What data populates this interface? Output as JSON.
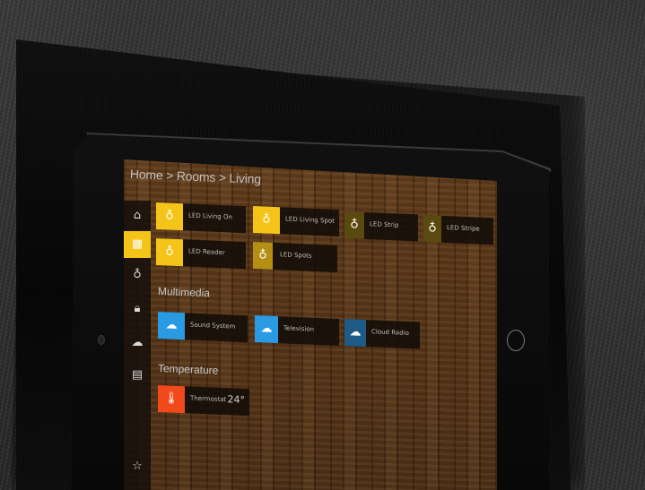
{
  "breadcrumb": "Home > Rooms > Living",
  "sidebar": [
    {
      "icon": "home-icon",
      "glyph": "⌂",
      "active": false
    },
    {
      "icon": "rooms-icon",
      "glyph": "▦",
      "active": true
    },
    {
      "icon": "light-bulb-icon",
      "glyph": "♁",
      "active": false
    },
    {
      "icon": "lock-icon",
      "glyph": "🔒︎",
      "active": false
    },
    {
      "icon": "cloud-icon",
      "glyph": "☁",
      "active": false
    },
    {
      "icon": "heater-icon",
      "glyph": "▤",
      "active": false
    },
    {
      "icon": "star-icon",
      "glyph": "☆",
      "active": false
    }
  ],
  "lighting": [
    {
      "label": "LED Living On",
      "state": "on"
    },
    {
      "label": "LED Living Spot Light",
      "state": "on"
    },
    {
      "label": "LED Strip",
      "state": "off"
    },
    {
      "label": "LED Stripe",
      "state": "off"
    },
    {
      "label": "LED Reader",
      "state": "on"
    },
    {
      "label": "LED Spots",
      "state": "dim"
    }
  ],
  "sections": {
    "multimedia": "Multimedia",
    "temperature": "Temperature"
  },
  "multimedia": [
    {
      "label": "Sound System",
      "state": "on"
    },
    {
      "label": "Television",
      "state": "on"
    },
    {
      "label": "Cloud Radio",
      "state": "off"
    }
  ],
  "temperature": {
    "label": "Thermostat",
    "value": "24°"
  },
  "colors": {
    "light_on": "#f4c418",
    "light_dim": "#b58f14",
    "light_off": "#5a4a10",
    "media_on": "#2a9be3",
    "media_off": "#1e5a86",
    "temp": "#f04a1c"
  }
}
